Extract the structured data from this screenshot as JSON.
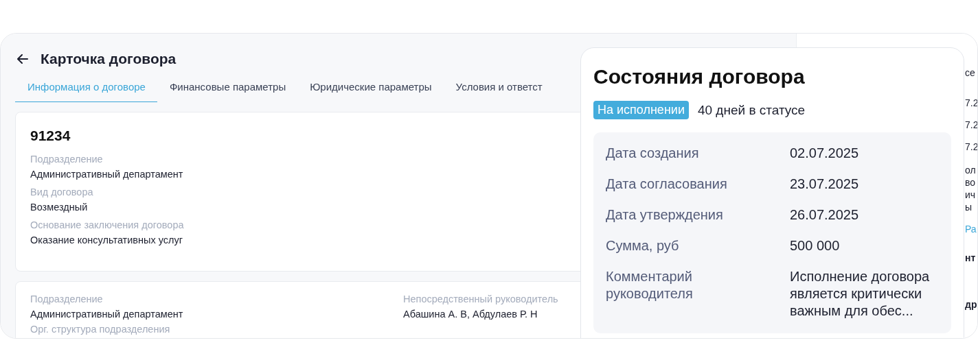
{
  "header": {
    "title": "Карточка договора"
  },
  "tabs": [
    {
      "label": "Информация о договоре",
      "selected": true
    },
    {
      "label": "Финансовые параметры",
      "selected": false
    },
    {
      "label": "Юридические параметры",
      "selected": false
    },
    {
      "label": "Условия и ответст",
      "selected": false
    }
  ],
  "main_card": {
    "number": "91234",
    "fields": [
      {
        "label": "Подразделение",
        "value": "Административный департамент"
      },
      {
        "label": "Вид договора",
        "value": "Возмездный"
      },
      {
        "label": "Основание заключения договора",
        "value": "Оказание консультативных услуг"
      }
    ]
  },
  "second_card": {
    "columns": [
      [
        {
          "label": "Подразделение",
          "value": "Административный департамент"
        },
        {
          "label": "Орг. структура подразделения"
        }
      ],
      [
        {
          "label": "Непосредственный руководитель",
          "value": "Абашина А. В, Абдулаев Р. Н"
        }
      ]
    ]
  },
  "side_panel": {
    "fragments": [
      {
        "text": "се",
        "kind": "plain"
      },
      {
        "text": "7.2",
        "kind": "plain"
      },
      {
        "text": "7.2",
        "kind": "plain"
      },
      {
        "text": "7.2",
        "kind": "plain"
      },
      {
        "text": "ол",
        "kind": "plain"
      },
      {
        "text": "во",
        "kind": "plain"
      },
      {
        "text": "ич",
        "kind": "plain"
      },
      {
        "text": "ы",
        "kind": "plain"
      },
      {
        "text": "Ра",
        "kind": "link"
      },
      {
        "text": "нт",
        "kind": "heading"
      },
      {
        "text": "др",
        "kind": "heading"
      }
    ]
  },
  "status_popup": {
    "title": "Состояния договора",
    "status": "На исполнении",
    "days": "40 дней в статусе",
    "rows": [
      {
        "label": "Дата создания",
        "value": "02.07.2025"
      },
      {
        "label": "Дата согласования",
        "value": "23.07.2025"
      },
      {
        "label": "Дата утверждения",
        "value": "26.07.2025"
      },
      {
        "label": "Сумма, руб",
        "value": "500 000"
      },
      {
        "label": "Комментарий руководителя",
        "value": "Исполнение договора является критически важным для обес..."
      }
    ]
  }
}
